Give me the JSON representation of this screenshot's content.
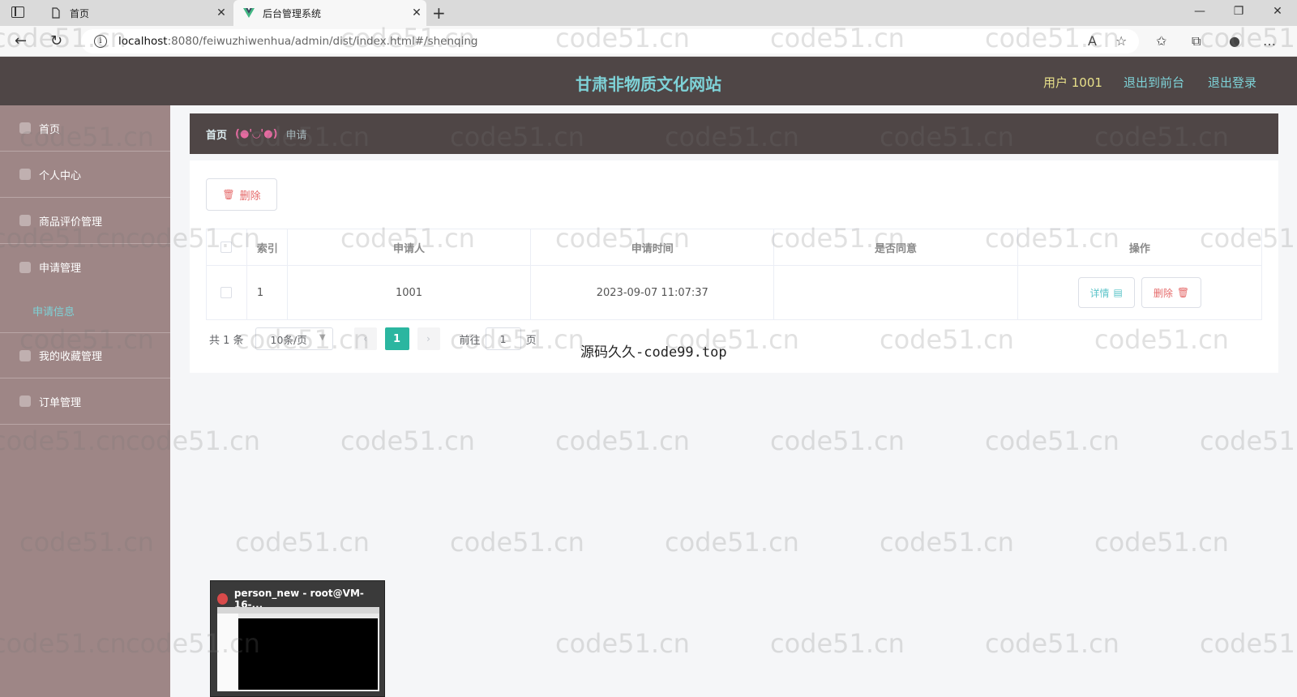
{
  "browser": {
    "tabs": [
      {
        "label": "首页"
      },
      {
        "label": "后台管理系统"
      }
    ],
    "url_host": "localhost",
    "url_path": ":8080/feiwuzhiwenhua/admin/dist/index.html#/shenqing",
    "window_controls": {
      "minimize": "—",
      "restore": "❐",
      "close": "✕"
    }
  },
  "header": {
    "title": "甘肃非物质文化网站",
    "user": "用户 1001",
    "to_front": "退出到前台",
    "logout": "退出登录"
  },
  "sidebar": {
    "items": [
      {
        "label": "首页"
      },
      {
        "label": "个人中心"
      },
      {
        "label": "商品评价管理"
      },
      {
        "label": "申请管理"
      },
      {
        "label": "我的收藏管理"
      },
      {
        "label": "订单管理"
      }
    ],
    "active_sub": "申请信息"
  },
  "breadcrumb": {
    "home": "首页",
    "separator": "(●'◡'●)",
    "current": "申请"
  },
  "toolbar": {
    "delete_label": "删除"
  },
  "table": {
    "columns": [
      "索引",
      "申请人",
      "申请时间",
      "是否同意",
      "操作"
    ],
    "rows": [
      {
        "index": "1",
        "applicant": "1001",
        "time": "2023-09-07 11:07:37",
        "agreed": "",
        "detail_label": "详情",
        "delete_label": "删除"
      }
    ]
  },
  "pagination": {
    "total": "共 1 条",
    "page_size": "10条/页",
    "current_page": "1",
    "goto_prefix": "前往",
    "goto_value": "1",
    "goto_suffix": "页"
  },
  "overlay_text": "源码久久-code99.top",
  "watermark": "code51.cn",
  "taskbar_thumb": {
    "title": "person_new - root@VM-16-..."
  },
  "colors": {
    "header_bg": "#4f4646",
    "sidebar_bg": "#9e8686",
    "accent": "#7ed2d7",
    "page_active": "#2bb6a0",
    "danger": "#e56a6a"
  }
}
